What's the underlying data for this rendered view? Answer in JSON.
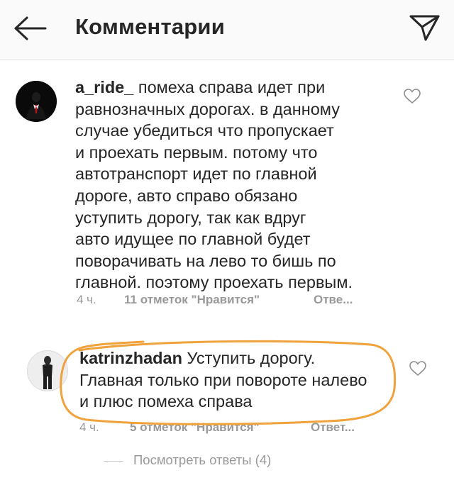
{
  "header": {
    "title": "Комментарии"
  },
  "comments": [
    {
      "username": "a_ride_",
      "text": "помеха справа идет при\nравнозначных дорогах.  в данному\nслучае убедиться что пропускает\nи проехать первым. потому что\nавтотранспорт идет по главной\nдороге, авто справо обязано\nуступить дорогу,  так как вдруг\nавто идущее по главной будет\nповорачивать на лево то бишь по\nглавной. поэтому проехать первым.",
      "time": "4 ч.",
      "likes": "11 отметок \"Нравится\"",
      "reply": "Отве..."
    },
    {
      "username": "katrinzhadan",
      "text": "Уступить дорогу.\nГлавная только при повороте налево\nи плюс помеха справа",
      "time": "4 ч.",
      "likes": "5 отметок \"Нравится\"",
      "reply": "Ответ..."
    }
  ],
  "view_replies": "Посмотреть ответы (4)",
  "colors": {
    "text": "#262626",
    "meta": "#999999",
    "annotation": "#f0a23c"
  },
  "icons": {
    "back": "arrow-left-icon",
    "send": "paper-plane-icon",
    "like": "heart-outline-icon"
  }
}
